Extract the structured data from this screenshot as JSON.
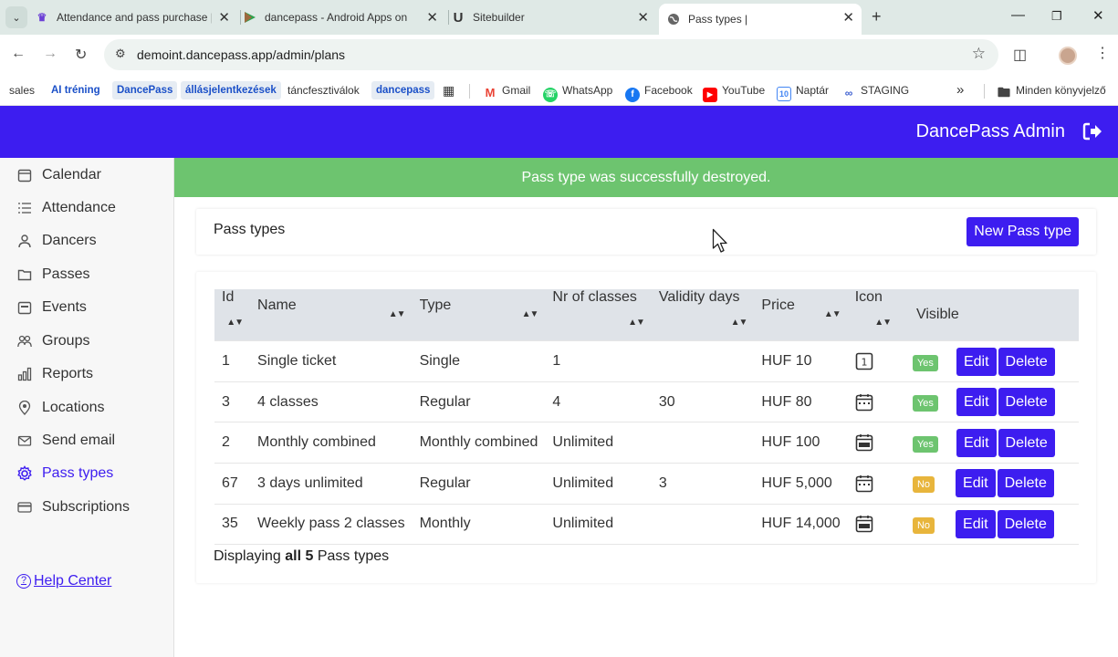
{
  "browser": {
    "tabs": [
      {
        "title": "Attendance and pass purchase |",
        "favicon": "sheets-icon"
      },
      {
        "title": "dancepass - Android Apps on G",
        "favicon": "play-store-icon"
      },
      {
        "title": "Sitebuilder",
        "favicon": "sitebuilder-icon"
      },
      {
        "title": "Pass types |",
        "favicon": "globe-icon",
        "active": true
      }
    ],
    "url": "demoint.dancepass.app/admin/plans",
    "bookmarks": [
      {
        "label": "sales",
        "style": "plain"
      },
      {
        "label": "AI tréning",
        "style": "blue"
      },
      {
        "label": "DancePass",
        "style": "chip"
      },
      {
        "label": "állásjelentkezések",
        "style": "chip"
      },
      {
        "label": "táncfesztiválok",
        "style": "plain"
      },
      {
        "label": "dancepass",
        "style": "chip"
      },
      {
        "label": "Gmail",
        "icon": "gmail-icon"
      },
      {
        "label": "WhatsApp",
        "icon": "whatsapp-icon"
      },
      {
        "label": "Facebook",
        "icon": "facebook-icon"
      },
      {
        "label": "YouTube",
        "icon": "youtube-icon"
      },
      {
        "label": "Naptár",
        "icon": "calendar-icon"
      },
      {
        "label": "STAGING",
        "icon": "staging-icon"
      }
    ],
    "all_bookmarks": "Minden könyvjelző"
  },
  "app": {
    "brand": "DancePass Admin",
    "accent": "#3d1df0",
    "success_color": "#6dc46f",
    "warning_color": "#e8b53c"
  },
  "sidebar": {
    "items": [
      {
        "label": "Calendar",
        "icon": "calendar-icon"
      },
      {
        "label": "Attendance",
        "icon": "list-icon"
      },
      {
        "label": "Dancers",
        "icon": "person-icon"
      },
      {
        "label": "Passes",
        "icon": "folder-icon"
      },
      {
        "label": "Events",
        "icon": "event-icon"
      },
      {
        "label": "Groups",
        "icon": "people-icon"
      },
      {
        "label": "Reports",
        "icon": "bar-chart-icon"
      },
      {
        "label": "Locations",
        "icon": "map-pin-icon"
      },
      {
        "label": "Send email",
        "icon": "envelope-icon"
      },
      {
        "label": "Pass types",
        "icon": "gear-icon",
        "active": true
      },
      {
        "label": "Subscriptions",
        "icon": "credit-card-icon"
      }
    ],
    "help": "Help Center"
  },
  "flash": "Pass type was successfully destroyed.",
  "page": {
    "title": "Pass types",
    "new_button": "New Pass type"
  },
  "table": {
    "headers": [
      "Id",
      "Name",
      "Type",
      "Nr of classes",
      "Validity days",
      "Price",
      "Icon",
      "Visible"
    ],
    "rows": [
      {
        "id": "1",
        "name": "Single ticket",
        "type": "Single",
        "classes": "1",
        "validity": "",
        "price": "HUF 10",
        "icon": "single-ticket-icon",
        "visible": "Yes"
      },
      {
        "id": "3",
        "name": "4 classes",
        "type": "Regular",
        "classes": "4",
        "validity": "30",
        "price": "HUF 80",
        "icon": "calendar-dots-icon",
        "visible": "Yes"
      },
      {
        "id": "2",
        "name": "Monthly combined",
        "type": "Monthly combined",
        "classes": "Unlimited",
        "validity": "",
        "price": "HUF 100",
        "icon": "calendar-month-icon",
        "visible": "Yes"
      },
      {
        "id": "67",
        "name": "3 days unlimited",
        "type": "Regular",
        "classes": "Unlimited",
        "validity": "3",
        "price": "HUF 5,000",
        "icon": "calendar-dots-icon",
        "visible": "No"
      },
      {
        "id": "35",
        "name": "Weekly pass 2 classes",
        "type": "Monthly",
        "classes": "Unlimited",
        "validity": "",
        "price": "HUF 14,000",
        "icon": "calendar-month-icon",
        "visible": "No"
      }
    ],
    "edit_label": "Edit",
    "delete_label": "Delete"
  },
  "summary": {
    "prefix": "Displaying",
    "bold": "all 5",
    "suffix": "Pass types"
  }
}
